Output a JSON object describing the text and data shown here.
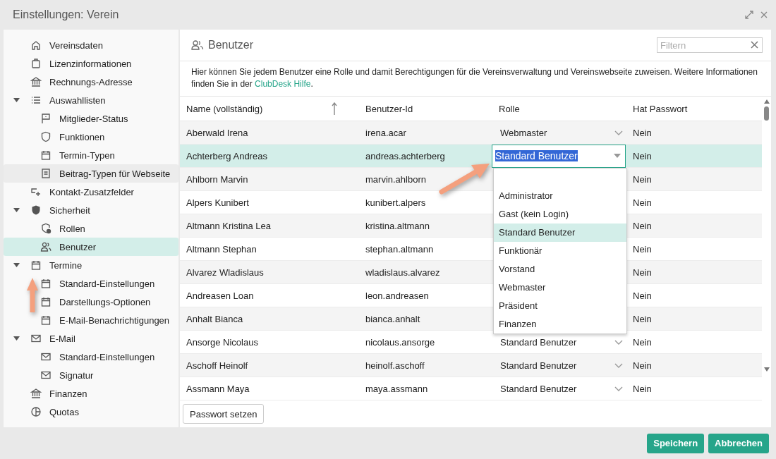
{
  "window": {
    "title": "Einstellungen: Verein"
  },
  "sidebar": {
    "items": [
      {
        "label": "Vereinsdaten",
        "selected": false,
        "hovered": false
      },
      {
        "label": "Lizenzinformationen",
        "selected": false,
        "hovered": false
      },
      {
        "label": "Rechnungs-Adresse",
        "selected": false,
        "hovered": false
      },
      {
        "label": "Auswahllisten",
        "selected": false,
        "hovered": false,
        "expanded": true,
        "children": [
          {
            "label": "Mitglieder-Status",
            "selected": false,
            "hovered": false
          },
          {
            "label": "Funktionen",
            "selected": false,
            "hovered": false
          },
          {
            "label": "Termin-Typen",
            "selected": false,
            "hovered": false
          },
          {
            "label": "Beitrag-Typen für Webseite",
            "selected": false,
            "hovered": true
          }
        ]
      },
      {
        "label": "Kontakt-Zusatzfelder",
        "selected": false,
        "hovered": false
      },
      {
        "label": "Sicherheit",
        "selected": false,
        "hovered": false,
        "expanded": true,
        "children": [
          {
            "label": "Rollen",
            "selected": false,
            "hovered": false
          },
          {
            "label": "Benutzer",
            "selected": true,
            "hovered": false
          }
        ]
      },
      {
        "label": "Termine",
        "selected": false,
        "hovered": false,
        "expanded": true,
        "children": [
          {
            "label": "Standard-Einstellungen",
            "selected": false,
            "hovered": false
          },
          {
            "label": "Darstellungs-Optionen",
            "selected": false,
            "hovered": false
          },
          {
            "label": "E-Mail-Benachrichtigungen",
            "selected": false,
            "hovered": false
          }
        ]
      },
      {
        "label": "E-Mail",
        "selected": false,
        "hovered": false,
        "expanded": true,
        "children": [
          {
            "label": "Standard-Einstellungen",
            "selected": false,
            "hovered": false
          },
          {
            "label": "Signatur",
            "selected": false,
            "hovered": false
          }
        ]
      },
      {
        "label": "Finanzen",
        "selected": false,
        "hovered": false
      },
      {
        "label": "Quotas",
        "selected": false,
        "hovered": false
      }
    ]
  },
  "panel": {
    "title": "Benutzer",
    "filter": {
      "placeholder": "Filtern"
    },
    "info": "Hier können Sie jedem Benutzer eine Rolle und damit Berechtigungen für die Vereinsverwaltung und Vereinswebseite zuweisen. Weitere Informationen finden Sie in der ",
    "info_link": "ClubDesk Hilfe",
    "info_end": "."
  },
  "table": {
    "columns": [
      "Name (vollständig)",
      "Benutzer-Id",
      "Rolle",
      "Hat Passwort"
    ],
    "rows": [
      {
        "name": "Aberwald Irena",
        "id": "irena.acar",
        "role": "Webmaster",
        "password": "Nein",
        "selected": false
      },
      {
        "name": "Achterberg Andreas",
        "id": "andreas.achterberg",
        "role": "Standard Benutzer",
        "password": "Nein",
        "selected": true
      },
      {
        "name": "Ahlborn Marvin",
        "id": "marvin.ahlborn",
        "password": "Nein",
        "selected": false
      },
      {
        "name": "Alpers Kunibert",
        "id": "kunibert.alpers",
        "password": "Nein",
        "selected": false
      },
      {
        "name": "Altmann Kristina Lea",
        "id": "kristina.altmann",
        "password": "Nein",
        "selected": false
      },
      {
        "name": "Altmann Stephan",
        "id": "stephan.altmann",
        "password": "Nein",
        "selected": false
      },
      {
        "name": "Alvarez Wladislaus",
        "id": "wladislaus.alvarez",
        "password": "Nein",
        "selected": false
      },
      {
        "name": "Andreasen Loan",
        "id": "leon.andreasen",
        "password": "Nein",
        "selected": false
      },
      {
        "name": "Anhalt Bianca",
        "id": "bianca.anhalt",
        "password": "Nein",
        "selected": false
      },
      {
        "name": "Ansorge Nicolaus",
        "id": "nicolaus.ansorge",
        "role": "Standard Benutzer",
        "password": "Nein",
        "selected": false
      },
      {
        "name": "Aschoff Heinolf",
        "id": "heinolf.aschoff",
        "role": "Standard Benutzer",
        "password": "Nein",
        "selected": false
      },
      {
        "name": "Assmann Maya",
        "id": "maya.assmann",
        "role": "Standard Benutzer",
        "password": "Nein",
        "selected": false
      }
    ]
  },
  "role_dropdown": {
    "options": [
      {
        "label": "Administrator",
        "selected": false
      },
      {
        "label": "Gast (kein Login)",
        "selected": false
      },
      {
        "label": "Standard Benutzer",
        "selected": true
      },
      {
        "label": "Funktionär",
        "selected": false
      },
      {
        "label": "Vorstand",
        "selected": false
      },
      {
        "label": "Webmaster",
        "selected": false
      },
      {
        "label": "Präsident",
        "selected": false
      },
      {
        "label": "Finanzen",
        "selected": false
      }
    ]
  },
  "buttons": [
    "Passwort setzen",
    "Speichern",
    "Abbrechen"
  ]
}
